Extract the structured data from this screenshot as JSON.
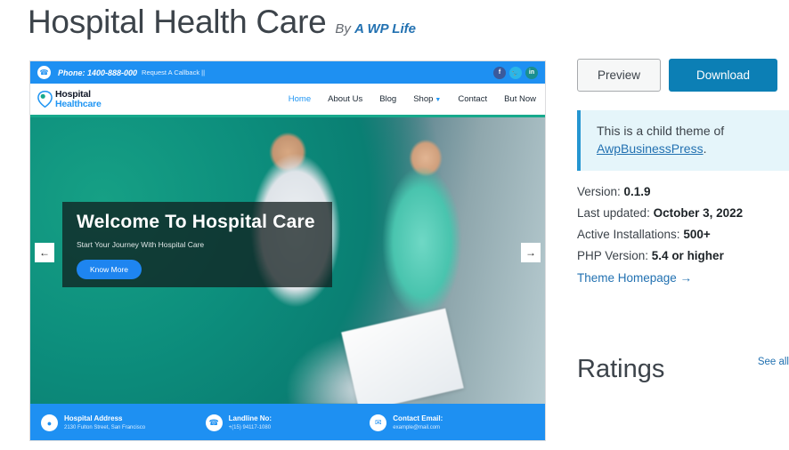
{
  "header": {
    "title": "Hospital Health Care",
    "by_label": "By",
    "author": "A WP Life"
  },
  "preview": {
    "topbar": {
      "phone_icon": "phone-icon",
      "phone_label": "Phone: 1400-888-000",
      "callback_label": "Request A Callback ||",
      "social": [
        {
          "name": "facebook",
          "glyph": "f"
        },
        {
          "name": "twitter",
          "glyph": "ᵛ"
        },
        {
          "name": "linkedin",
          "glyph": "in"
        }
      ]
    },
    "logo": {
      "line1": "Hospital",
      "line2": "Healthcare"
    },
    "nav": [
      {
        "label": "Home",
        "active": true
      },
      {
        "label": "About Us",
        "active": false
      },
      {
        "label": "Blog",
        "active": false
      },
      {
        "label": "Shop",
        "active": false,
        "has_dropdown": true
      },
      {
        "label": "Contact",
        "active": false
      },
      {
        "label": "But Now",
        "active": false
      }
    ],
    "hero": {
      "title": "Welcome To Hospital Care",
      "subtitle": "Start Your Journey With Hospital Care",
      "button": "Know More",
      "prev_arrow": "←",
      "next_arrow": "→"
    },
    "footer": [
      {
        "icon": "location-pin-icon",
        "glyph": "●",
        "title": "Hospital Address",
        "detail": "2130 Fulton Street, San Francisco"
      },
      {
        "icon": "phone-icon",
        "glyph": "✆",
        "title": "Landline No:",
        "detail": "+(15) 94117-1080"
      },
      {
        "icon": "email-icon",
        "glyph": "✉",
        "title": "Contact Email:",
        "detail": "example@mail.com"
      }
    ]
  },
  "sidebar": {
    "preview_button": "Preview",
    "download_button": "Download",
    "notice": {
      "text_before": "This is a child theme of ",
      "link": "AwpBusinessPress",
      "text_after": "."
    },
    "meta": [
      {
        "label": "Version: ",
        "value": "0.1.9"
      },
      {
        "label": "Last updated: ",
        "value": "October 3, 2022"
      },
      {
        "label": "Active Installations: ",
        "value": "500+"
      },
      {
        "label": "PHP Version: ",
        "value": "5.4 or higher"
      }
    ],
    "homepage_link": "Theme Homepage →",
    "ratings_title": "Ratings",
    "see_all": "See all"
  },
  "colors": {
    "accent_blue": "#2271b1",
    "download_blue": "#0c7fb5",
    "theme_blue": "#1e90f2",
    "notice_bg": "#e5f5fa",
    "hero_teal": "#10a88d"
  }
}
